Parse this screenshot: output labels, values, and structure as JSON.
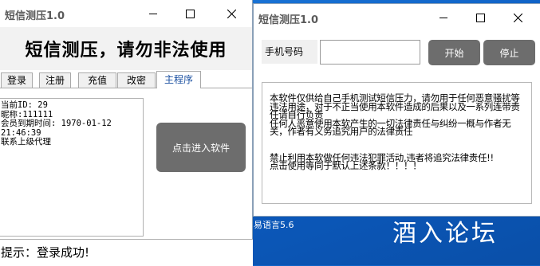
{
  "left_window": {
    "title": "短信测压1.0",
    "banner": "短信测压，请勿非法使用",
    "tabs": [
      {
        "label": "登录"
      },
      {
        "label": "注册"
      },
      {
        "label": "充值"
      },
      {
        "label": "改密"
      },
      {
        "label": "主程序",
        "active": true
      }
    ],
    "info_text": "当前ID: 29\n昵称:111111\n会员到期时间: 1970-01-12\n21:46:39\n联系上级代理",
    "enter_button": "点击进入软件",
    "status": "提示：登录成功!"
  },
  "right_window": {
    "title": "短信测压1.0",
    "phone_label": "手机号码",
    "phone_value": "",
    "start_button": "开始",
    "stop_button": "停止",
    "notice_1": "本软件仅供给自己手机测试短信压力，请勿用于任何恶意骚扰等违法用途，对于不正当使用本软件造成的后果以及一系列连带责任请自行负责",
    "notice_2": "任何人恶意使用本软产生的一切法律责任与纠纷一概与作者无关，作者有义务追究用户的法律责任",
    "notice_3": "禁止利用本软做任何违法犯罪活动,违者将追究法律责任!!",
    "notice_4": "点击使用等同于默认上述条款！！！！"
  },
  "taskbar_text": "易语言5.6",
  "watermark": "酒入论坛",
  "colors": {
    "desktop": "#0c5bc0",
    "button_dark": "#6d6d6d",
    "window_bg": "#ffffff"
  },
  "icons": [
    "minimize-icon",
    "maximize-icon",
    "close-icon"
  ]
}
